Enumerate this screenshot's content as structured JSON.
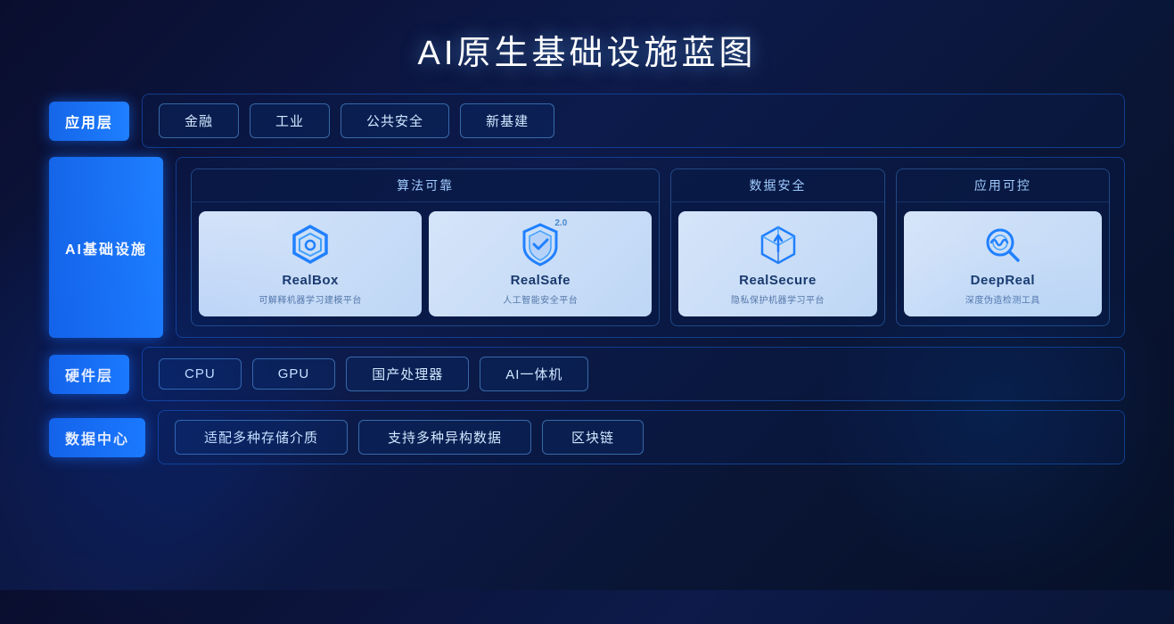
{
  "title": "AI原生基础设施蓝图",
  "layers": {
    "application": {
      "label": "应用层",
      "items": [
        "金融",
        "工业",
        "公共安全",
        "新基建"
      ]
    },
    "ai_infra": {
      "label": "AI基础设施",
      "categories": [
        {
          "name": "算法可靠",
          "products": [
            {
              "id": "realbox",
              "name": "RealBox",
              "desc": "可解释机器学习建模平台",
              "version": ""
            },
            {
              "id": "realsafe",
              "name": "RealSafe",
              "desc": "人工智能安全平台",
              "version": "2.0"
            }
          ]
        },
        {
          "name": "数据安全",
          "products": [
            {
              "id": "realsecure",
              "name": "RealSecure",
              "desc": "隐私保护机器学习平台",
              "version": ""
            }
          ]
        },
        {
          "name": "应用可控",
          "products": [
            {
              "id": "deepreal",
              "name": "DeepReal",
              "desc": "深度伪造检测工具",
              "version": ""
            }
          ]
        }
      ]
    },
    "hardware": {
      "label": "硬件层",
      "items": [
        "CPU",
        "GPU",
        "国产处理器",
        "AI一体机"
      ]
    },
    "data_center": {
      "label": "数据中心",
      "items": [
        "适配多种存储介质",
        "支持多种异构数据",
        "区块链"
      ]
    }
  }
}
